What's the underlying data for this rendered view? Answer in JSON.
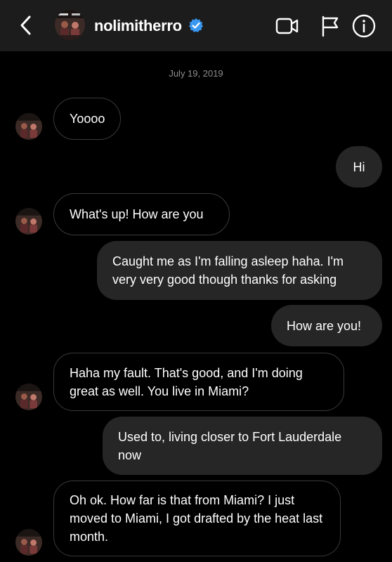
{
  "header": {
    "username": "nolimitherro",
    "verified": true
  },
  "conversation": {
    "date": "July 19, 2019",
    "messages": [
      {
        "from": "them",
        "text": "Yoooo"
      },
      {
        "from": "me",
        "text": "Hi"
      },
      {
        "from": "them",
        "text": "What's up! How are you"
      },
      {
        "from": "me",
        "text": "Caught me as I'm falling asleep haha. I'm very very good though thanks for asking"
      },
      {
        "from": "me",
        "text": "How are you!"
      },
      {
        "from": "them",
        "text": "Haha my fault. That's good, and I'm doing great as well. You live in Miami?"
      },
      {
        "from": "me",
        "text": "Used to, living closer to Fort Lauderdale now"
      },
      {
        "from": "them",
        "text": "Oh ok. How far is that from Miami? I just moved to Miami, I got drafted by the heat last month."
      }
    ]
  },
  "icons": {
    "back": "chevron-left-icon",
    "verified": "verified-badge-icon",
    "video": "video-call-icon",
    "flag": "flag-icon",
    "info": "info-icon"
  },
  "colors": {
    "background": "#000000",
    "header": "#1c1c1c",
    "outgoing_bubble": "#262626",
    "incoming_border": "#3a3a3a",
    "verified_blue": "#3897f0"
  }
}
